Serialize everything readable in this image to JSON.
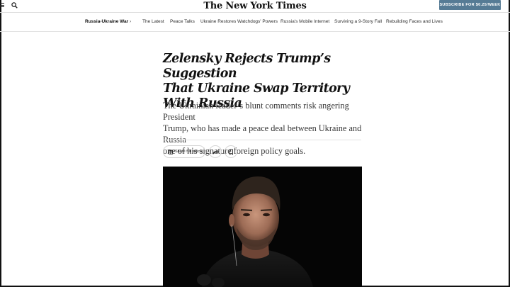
{
  "header": {
    "logo": "The New York Times",
    "subscribe_label": "SUBSCRIBE FOR $0.25/WEEK"
  },
  "section_nav": {
    "main_label": "Russia-Ukraine War",
    "chevron": "›",
    "items": [
      {
        "label": "The Latest"
      },
      {
        "label": "Peace Talks"
      },
      {
        "label": "Ukraine Restores Watchdogs' Powers"
      },
      {
        "label": "Russia's Mobile Internet"
      },
      {
        "label": "Surviving a 9-Story Fall"
      },
      {
        "label": "Rebuilding Faces and Lives"
      }
    ]
  },
  "article": {
    "headline_lines": [
      "Zelensky Rejects Trump’s Suggestion",
      "That Ukraine Swap Territory",
      "With Russia"
    ],
    "summary_lines": [
      "The Ukrainian leader’s blunt comments risk angering President",
      "Trump, who has made a peace deal between Ukraine and Russia",
      "one of his signature foreign policy goals."
    ],
    "share_label": "Share full article"
  },
  "icons": {
    "menu": "menu-icon",
    "search": "search-icon",
    "gift": "gift-icon",
    "share": "share-arrow-icon",
    "bookmark": "bookmark-icon"
  },
  "colors": {
    "subscribe_bg": "#567b95",
    "photo_bg": "#050505"
  }
}
